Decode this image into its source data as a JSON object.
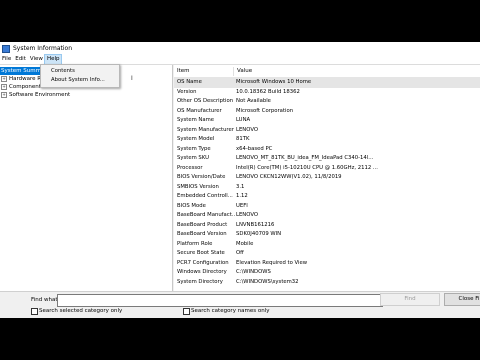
{
  "window": {
    "title": "System Information"
  },
  "menu": [
    "File",
    "Edit",
    "View",
    "Help"
  ],
  "help_menu": {
    "items": [
      "Contents",
      "About System Info..."
    ]
  },
  "tree": [
    {
      "label": "System Summ",
      "expandable": false,
      "selected": true
    },
    {
      "label": "Hardware R",
      "expandable": true,
      "selected": false
    },
    {
      "label": "Components",
      "expandable": true,
      "selected": false
    },
    {
      "label": "Software Environment",
      "expandable": true,
      "selected": false
    }
  ],
  "table": {
    "headers": [
      "Item",
      "Value"
    ],
    "rows": [
      [
        "OS Name",
        "Microsoft Windows 10 Home"
      ],
      [
        "Version",
        "10.0.18362 Build 18362"
      ],
      [
        "Other OS Description",
        "Not Available"
      ],
      [
        "OS Manufacturer",
        "Microsoft Corporation"
      ],
      [
        "System Name",
        "LUNA"
      ],
      [
        "System Manufacturer",
        "LENOVO"
      ],
      [
        "System Model",
        "81TK"
      ],
      [
        "System Type",
        "x64-based PC"
      ],
      [
        "System SKU",
        "LENOVO_MT_81TK_BU_idea_FM_IdeaPad C340-14l..."
      ],
      [
        "Processor",
        "Intel(R) Core(TM) i5-10210U CPU @ 1.60GHz, 2112 ..."
      ],
      [
        "BIOS Version/Date",
        "LENOVO CKCN12WW(V1.02), 11/8/2019"
      ],
      [
        "SMBIOS Version",
        "3.1"
      ],
      [
        "Embedded Controll...",
        "1.12"
      ],
      [
        "BIOS Mode",
        "UEFI"
      ],
      [
        "BaseBoard Manufact...",
        "LENOVO"
      ],
      [
        "BaseBoard Product",
        "LNVNB161216"
      ],
      [
        "BaseBoard Version",
        "SDK0J40709 WIN"
      ],
      [
        "Platform Role",
        "Mobile"
      ],
      [
        "Secure Boot State",
        "Off"
      ],
      [
        "PCR7 Configuration",
        "Elevation Required to View"
      ],
      [
        "Windows Directory",
        "C:\\WINDOWS"
      ],
      [
        "System Directory",
        "C:\\WINDOWS\\system32"
      ]
    ]
  },
  "find": {
    "label": "Find what:",
    "value": "",
    "find_button": "Find",
    "close_button": "Close Fi",
    "search_selected": "Search selected category only",
    "search_names": "Search category names only"
  }
}
